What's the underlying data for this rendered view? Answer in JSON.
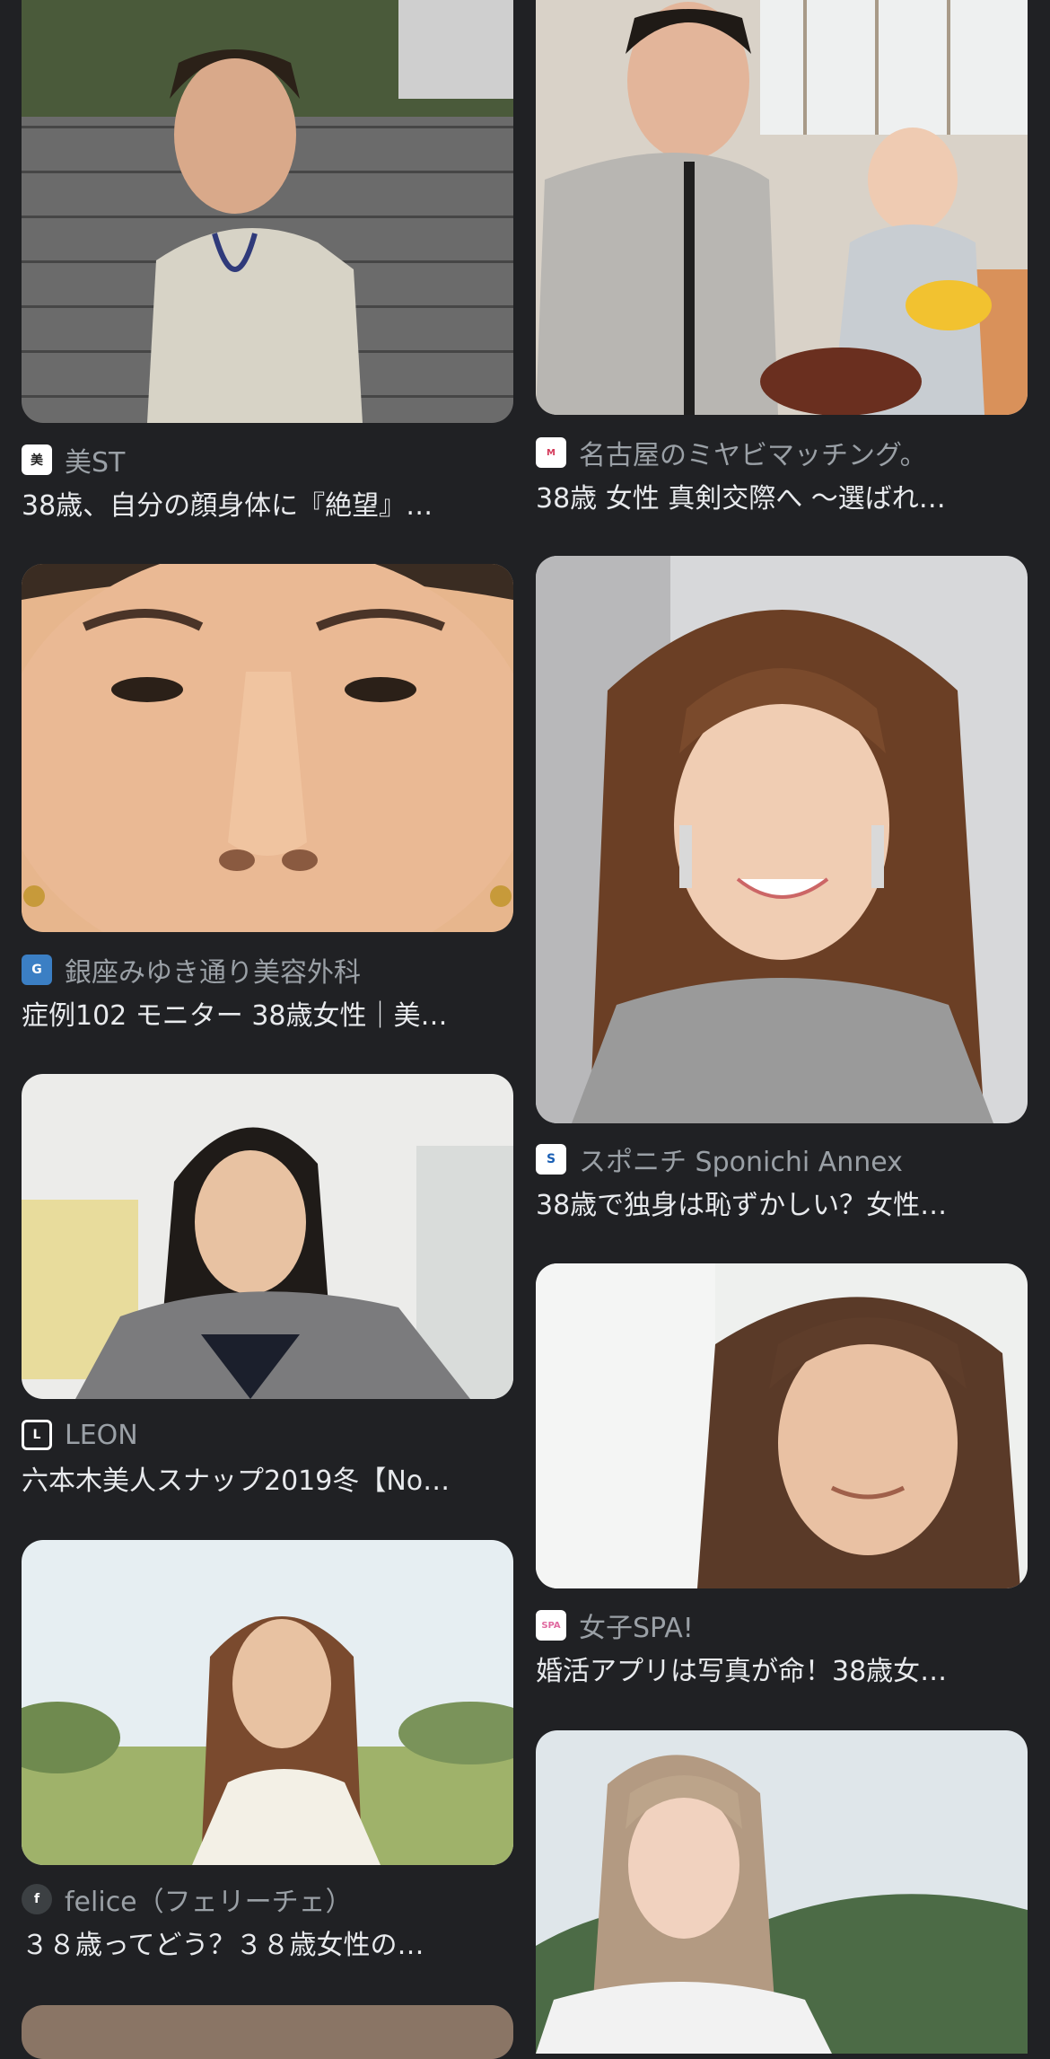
{
  "results": [
    {
      "source": "美ST",
      "title": "38歳、自分の顔身体に『絶望』…",
      "favicon_color": "#ffffff",
      "favicon_text": "美"
    },
    {
      "source": "名古屋のミヤビマッチング。",
      "title": "38歳 女性 真剣交際へ 〜選ばれ…",
      "favicon_color": "#ffffff",
      "favicon_text": "M"
    },
    {
      "source": "銀座みゆき通り美容外科",
      "title": "症例102 モニター 38歳女性｜美…",
      "favicon_color": "#3b7fc4",
      "favicon_text": "G"
    },
    {
      "source": "スポニチ Sponichi Annex",
      "title": "38歳で独身は恥ずかしい？女性…",
      "favicon_color": "#ffffff",
      "favicon_text": "S"
    },
    {
      "source": "LEON",
      "title": "六本木美人スナップ2019冬【No…",
      "favicon_color": "#202124",
      "favicon_text": "L"
    },
    {
      "source": "女子SPA!",
      "title": "婚活アプリは写真が命！38歳女…",
      "favicon_color": "#ffffff",
      "favicon_text": "SPA"
    },
    {
      "source": "felice（フェリーチェ）",
      "title": "３８歳ってどう？３８歳女性の…",
      "favicon_color": "#3c4043",
      "favicon_text": "f"
    },
    {
      "source": "",
      "title": "",
      "favicon_color": "",
      "favicon_text": ""
    }
  ]
}
